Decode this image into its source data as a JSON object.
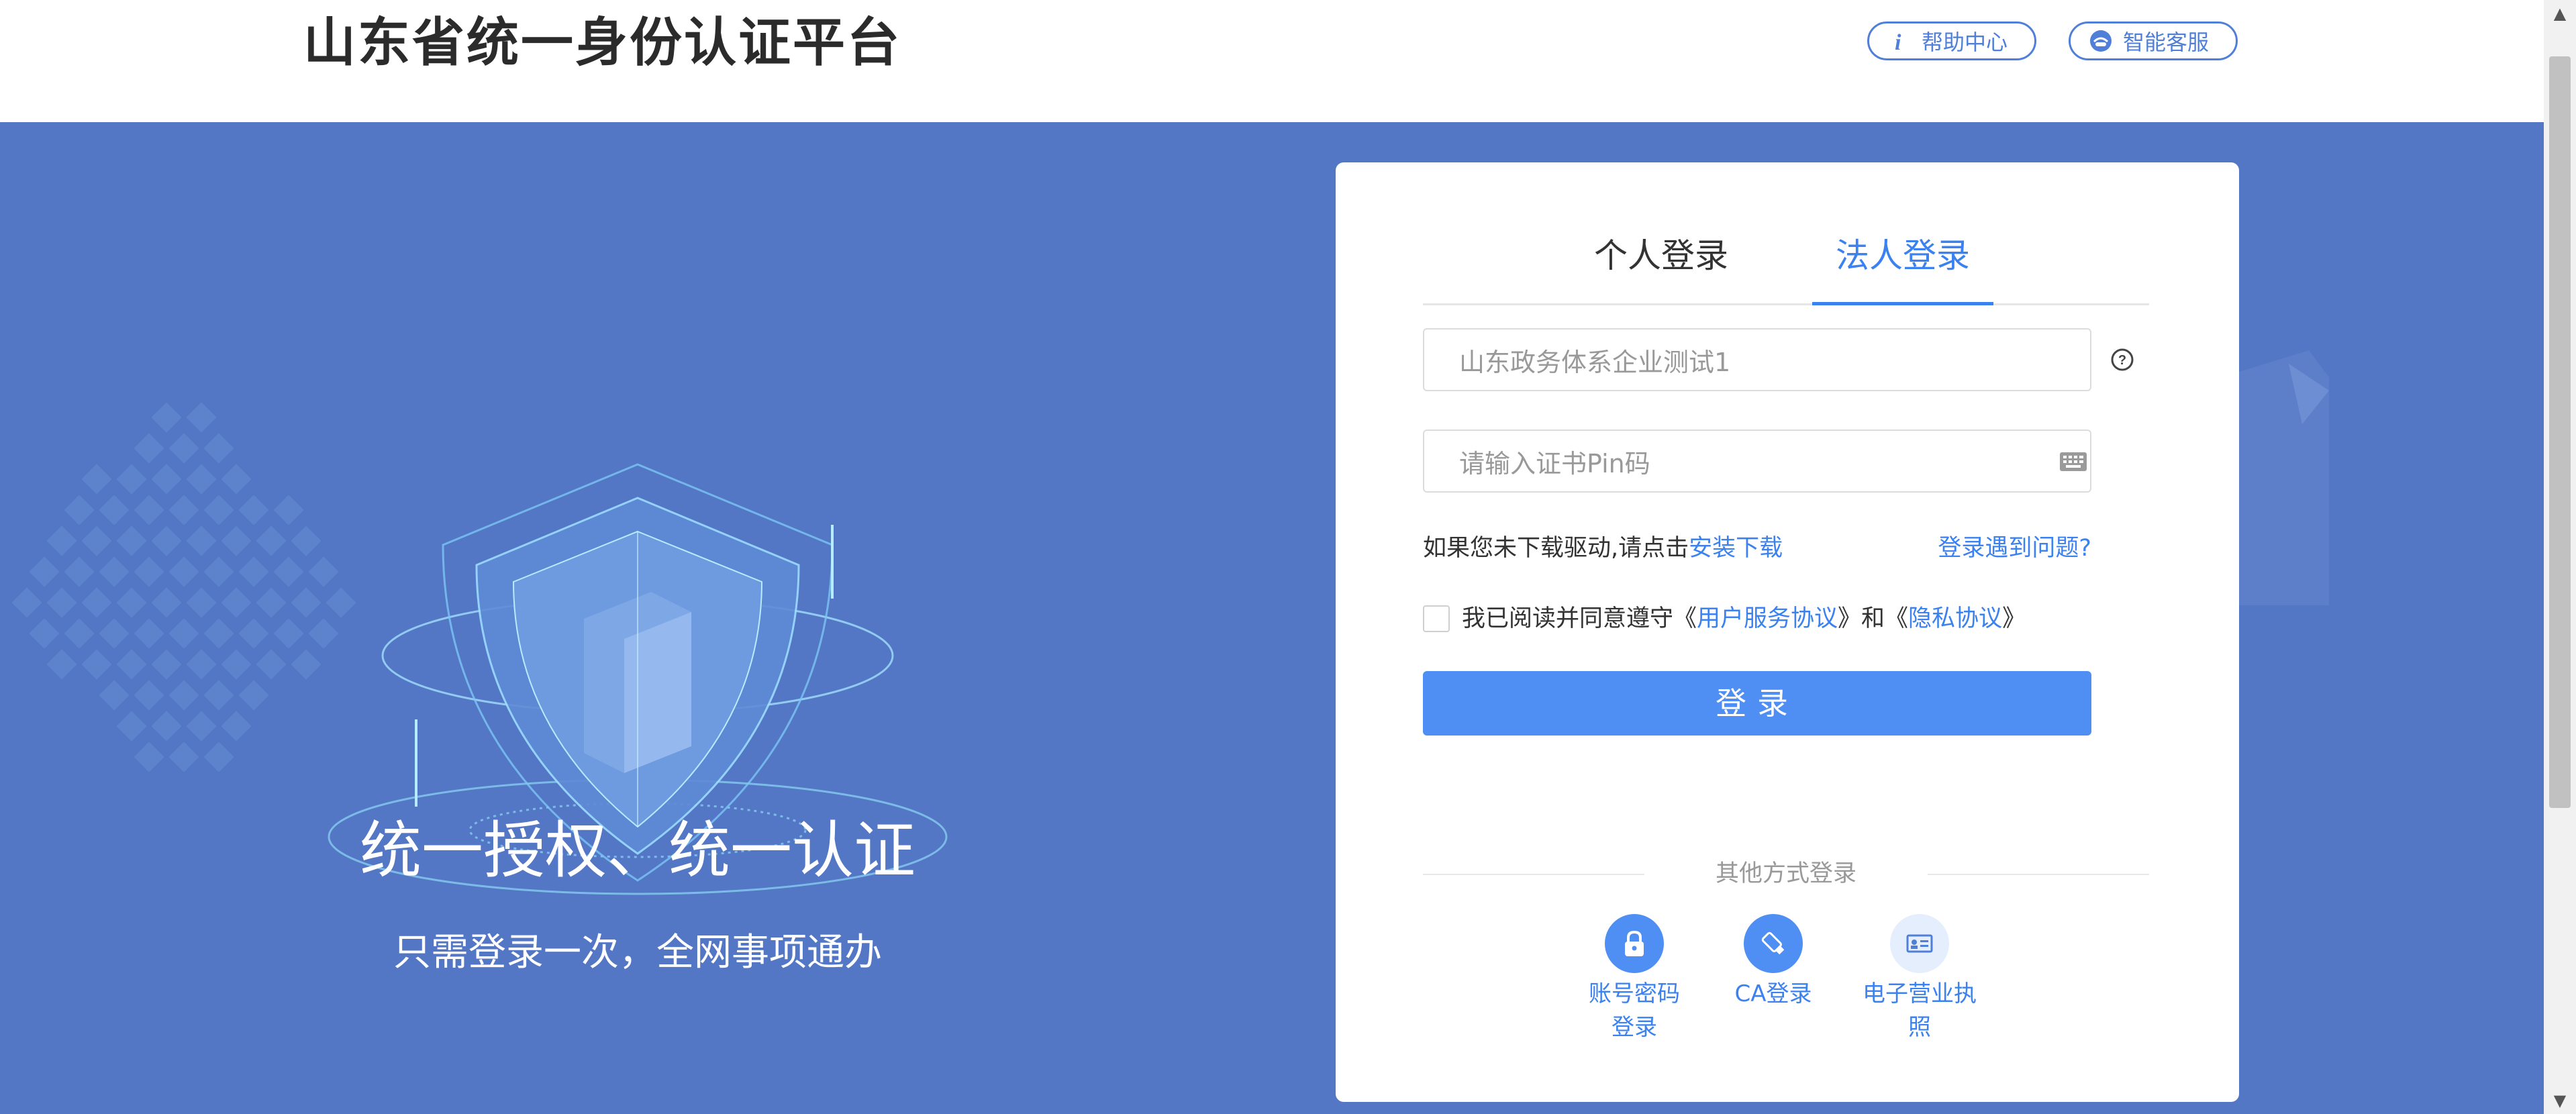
{
  "header": {
    "site_title": "山东省统一身份认证平台",
    "help_label": "帮助中心",
    "service_label": "智能客服"
  },
  "hero": {
    "slogan_main": "统一授权、统一认证",
    "slogan_sub": "只需登录一次，全网事项通办"
  },
  "login": {
    "tabs": [
      {
        "label": "个人登录",
        "active": false
      },
      {
        "label": "法人登录",
        "active": true
      }
    ],
    "enterprise_value": "山东政务体系企业测试1",
    "pin_placeholder": "请输入证书Pin码",
    "driver_text": "如果您未下载驱动,请点击",
    "install_link": "安装下载",
    "problem_link": "登录遇到问题?",
    "agree_prefix": "我已阅读并同意遵守《",
    "user_agreement": "用户服务协议",
    "agree_mid": "》和《",
    "privacy_agreement": "隐私协议",
    "agree_suffix": "》",
    "login_button": "登录",
    "other_title": "其他方式登录",
    "alt_methods": [
      {
        "label_line1": "账号密码",
        "label_line2": "登录",
        "icon": "lock-icon"
      },
      {
        "label_line1": "CA登录",
        "label_line2": "",
        "icon": "usb-key-icon"
      },
      {
        "label_line1": "电子营业执",
        "label_line2": "照",
        "icon": "business-license-icon"
      }
    ]
  },
  "colors": {
    "accent": "#4f8ef2",
    "link": "#3b82f0",
    "hero_bg": "#5377c5"
  }
}
